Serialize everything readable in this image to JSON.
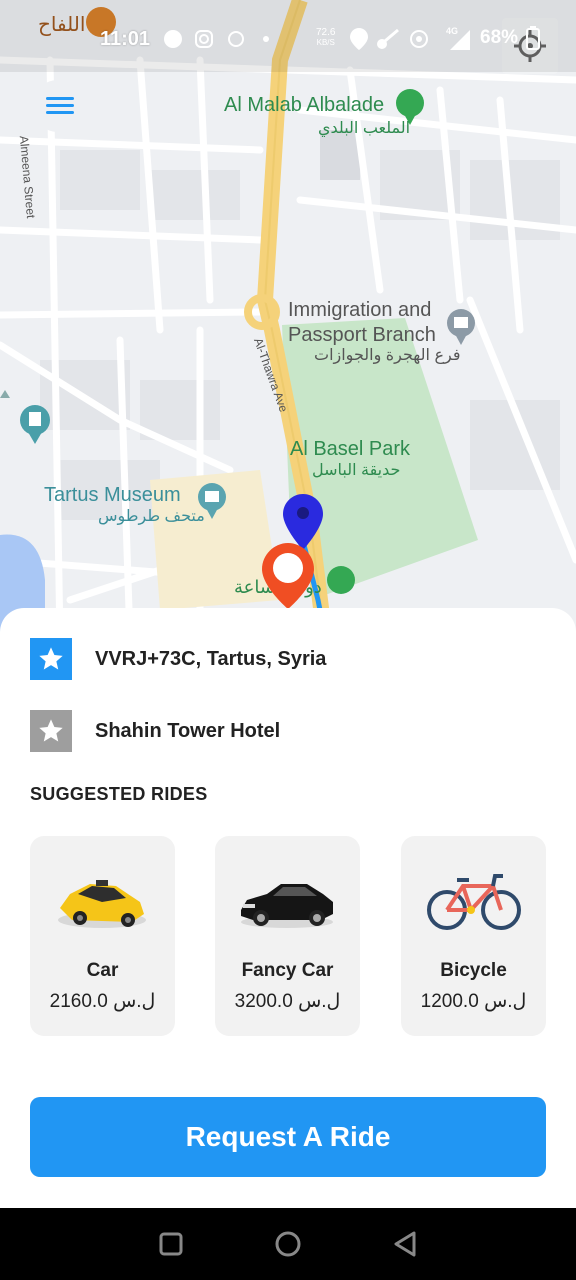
{
  "status_bar": {
    "time": "11:01",
    "network_speed": "72.6",
    "network_unit": "KB/S",
    "network_type": "4G",
    "battery": "68%"
  },
  "map": {
    "labels": {
      "top_left_arabic": "اللفاح",
      "stadium_en": "Al Malab Albalade",
      "stadium_ar": "الملعب البلدي",
      "street_left": "Almeena Street",
      "street_main": "Al-Thawra Ave",
      "immigration_en_1": "Immigration and",
      "immigration_en_2": "Passport Branch",
      "immigration_ar": "فرع الهجرة والجوازات",
      "park_en": "Al Basel Park",
      "park_ar": "حديقة الباسل",
      "museum_en": "Tartus Museum",
      "museum_ar": "متحف طرطوس",
      "bottom_ar": "دوار الساعة"
    }
  },
  "addresses": {
    "pickup": "VVRJ+73C, Tartus, Syria",
    "destination": "Shahin Tower Hotel"
  },
  "suggested": {
    "title": "SUGGESTED RIDES",
    "rides": [
      {
        "name": "Car",
        "price": "2160.0 ل.س"
      },
      {
        "name": "Fancy Car",
        "price": "3200.0 ل.س"
      },
      {
        "name": "Bicycle",
        "price": "1200.0 ل.س"
      }
    ]
  },
  "actions": {
    "request_label": "Request A Ride"
  },
  "colors": {
    "accent": "#2196f3",
    "pickup_star_bg": "#2196f3",
    "destination_star_bg": "#9e9e9e",
    "park": "#c8e6c9",
    "main_road": "#f5d27a"
  }
}
